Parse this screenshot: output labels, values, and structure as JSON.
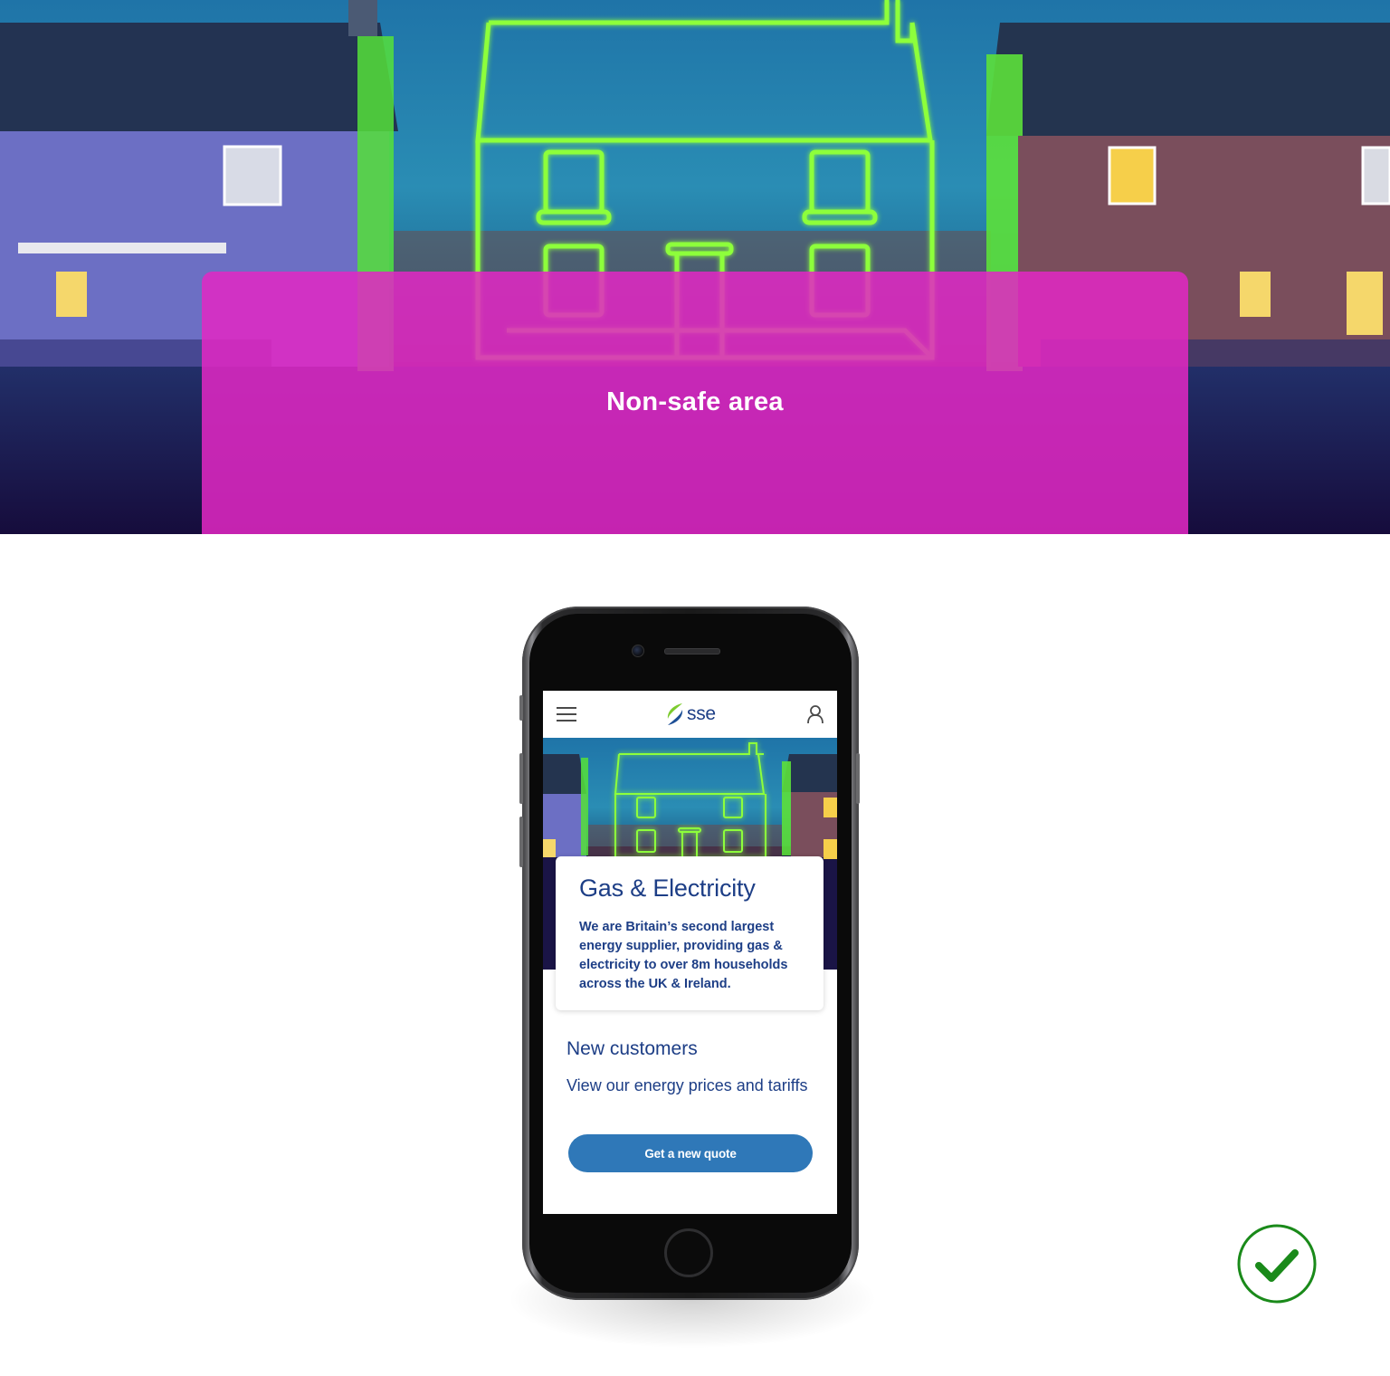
{
  "hero": {
    "overlay_label": "Non-safe area",
    "overlay_color": "#e228c4"
  },
  "mobile": {
    "brand": "sse",
    "card": {
      "title": "Gas & Electricity",
      "body": "We are Britain’s second largest energy supplier, providing gas & electricity to over 8m households across the UK & Ireland."
    },
    "new_customers": {
      "title": "New customers",
      "subtitle": "View our energy prices and tariffs",
      "button": "Get a new quote"
    },
    "colors": {
      "brand_blue": "#1d3e86",
      "button_blue": "#2f78b8",
      "check_green": "#1a8a1a"
    }
  },
  "icons": [
    "menu-icon",
    "user-icon",
    "sse-logo-icon",
    "checkmark-icon"
  ]
}
